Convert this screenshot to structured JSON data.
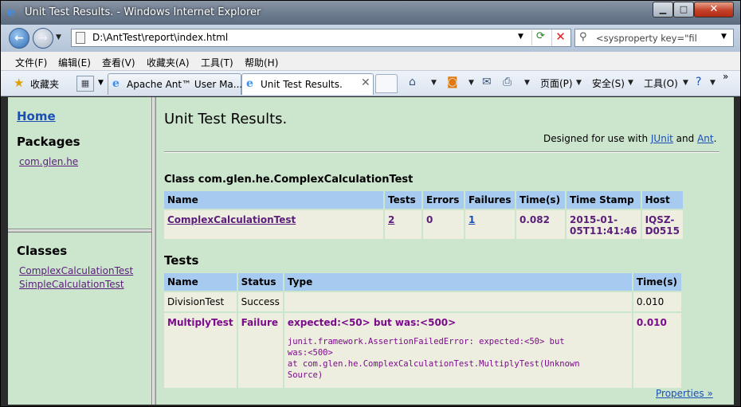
{
  "window": {
    "title": "Unit Test Results. - Windows Internet Explorer"
  },
  "address": {
    "url": "D:\\AntTest\\report\\index.html"
  },
  "search": {
    "placeholder": "<sysproperty key=\"fil"
  },
  "menu": [
    "文件(F)",
    "编辑(E)",
    "查看(V)",
    "收藏夹(A)",
    "工具(T)",
    "帮助(H)"
  ],
  "favorites": {
    "label": "收藏夹"
  },
  "tabs": [
    {
      "label": "Apache Ant™ User Ma..."
    },
    {
      "label": "Unit Test Results."
    }
  ],
  "toolbar": {
    "page": "页面(P)",
    "safety": "安全(S)",
    "tools": "工具(O)",
    "more": "»"
  },
  "sidebar": {
    "home": "Home",
    "packages_heading": "Packages",
    "package": "com.glen.he",
    "classes_heading": "Classes",
    "classes": [
      "ComplexCalculationTest",
      "SimpleCalculationTest"
    ]
  },
  "main": {
    "title": "Unit Test Results.",
    "designed_prefix": "Designed for use with ",
    "junit": "JUnit",
    "and": " and ",
    "ant": "Ant",
    "dot": ".",
    "class_heading": "Class com.glen.he.ComplexCalculationTest",
    "summary_headers": [
      "Name",
      "Tests",
      "Errors",
      "Failures",
      "Time(s)",
      "Time Stamp",
      "Host"
    ],
    "summary_row": {
      "name": "ComplexCalculationTest",
      "tests": "2",
      "errors": "0",
      "failures": "1",
      "time": "0.082",
      "timestamp_1": "2015-01-",
      "timestamp_2": "05T11:41:46",
      "host_1": "IQSZ-",
      "host_2": "D0515"
    },
    "tests_heading": "Tests",
    "tests_headers": [
      "Name",
      "Status",
      "Type",
      "Time(s)"
    ],
    "tests_rows": [
      {
        "name": "DivisionTest",
        "status": "Success",
        "type": "",
        "time": "0.010"
      },
      {
        "name": "MultiplyTest",
        "status": "Failure",
        "type": "expected:<50> but was:<500>",
        "trace_1": "junit.framework.AssertionFailedError: expected:<50> but",
        "trace_2": "was:<500>",
        "trace_3": "at com.glen.he.ComplexCalculationTest.MultiplyTest(Unknown",
        "trace_4": "Source)",
        "time": "0.010"
      }
    ],
    "properties": "Properties »"
  }
}
